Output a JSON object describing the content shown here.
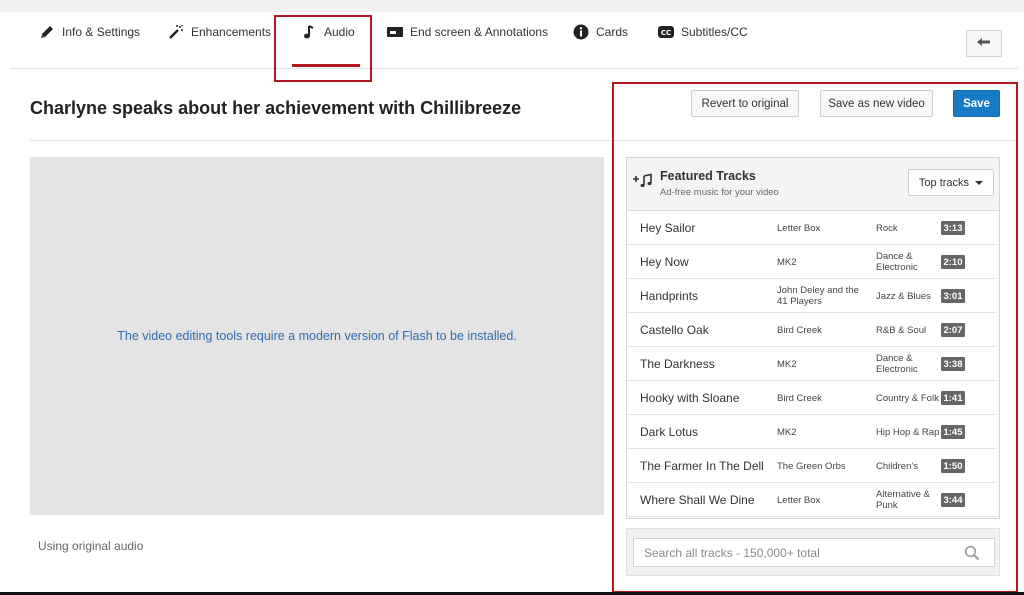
{
  "tabs": [
    {
      "label": "Info & Settings",
      "icon": "pencil-icon"
    },
    {
      "label": "Enhancements",
      "icon": "magic-wand-icon"
    },
    {
      "label": "Audio",
      "icon": "music-note-icon"
    },
    {
      "label": "End screen & Annotations",
      "icon": "end-screen-icon"
    },
    {
      "label": "Cards",
      "icon": "info-icon"
    },
    {
      "label": "Subtitles/CC",
      "icon": "closed-caption-icon"
    }
  ],
  "active_tab": "Audio",
  "header": {
    "back_icon": "back-arrow-icon"
  },
  "video": {
    "title": "Charlyne speaks about her achievement with Chillibreeze",
    "flash_message": "The video editing tools require a modern version of Flash to be installed.",
    "audio_status": "Using original audio"
  },
  "actions": {
    "revert_label": "Revert to original",
    "save_new_label": "Save as new video",
    "save_label": "Save"
  },
  "tracks": {
    "title": "Featured Tracks",
    "subtitle": "Ad-free music for your video",
    "sort_label": "Top tracks",
    "items": [
      {
        "name": "Hey Sailor",
        "artist": "Letter Box",
        "genre": "Rock",
        "duration": "3:13"
      },
      {
        "name": "Hey Now",
        "artist": "MK2",
        "genre": "Dance & Electronic",
        "duration": "2:10"
      },
      {
        "name": "Handprints",
        "artist": "John Deley and the 41 Players",
        "genre": "Jazz & Blues",
        "duration": "3:01"
      },
      {
        "name": "Castello Oak",
        "artist": "Bird Creek",
        "genre": "R&B & Soul",
        "duration": "2:07"
      },
      {
        "name": "The Darkness",
        "artist": "MK2",
        "genre": "Dance & Electronic",
        "duration": "3:38"
      },
      {
        "name": "Hooky with Sloane",
        "artist": "Bird Creek",
        "genre": "Country & Folk",
        "duration": "1:41"
      },
      {
        "name": "Dark Lotus",
        "artist": "MK2",
        "genre": "Hip Hop & Rap",
        "duration": "1:45"
      },
      {
        "name": "The Farmer In The Dell",
        "artist": "The Green Orbs",
        "genre": "Children's",
        "duration": "1:50"
      },
      {
        "name": "Where Shall We Dine",
        "artist": "Letter Box",
        "genre": "Alternative & Punk",
        "duration": "3:44"
      }
    ]
  },
  "search": {
    "placeholder": "Search all tracks - 150,000+ total",
    "value": ""
  },
  "colors": {
    "accent": "#b2171d",
    "save_button": "#167ac6",
    "link_text": "#2f6bb3",
    "duration_badge": "#666666"
  }
}
